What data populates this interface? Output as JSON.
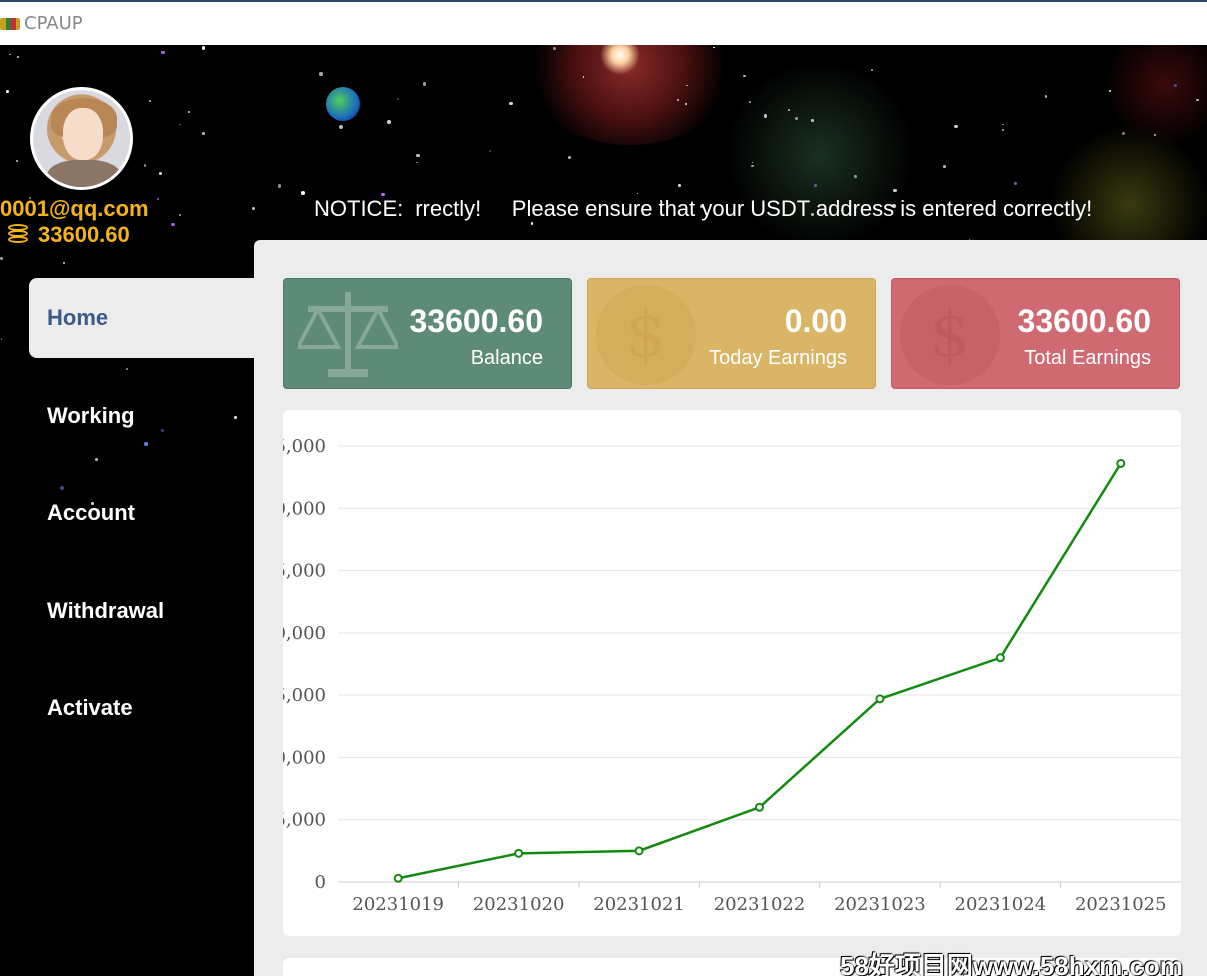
{
  "window": {
    "title": "CPAUP",
    "logo_icon": "app-logo-icon"
  },
  "user": {
    "email": "0001@qq.com",
    "balance": "33600.60",
    "coin_icon": "coins-stack-icon",
    "accent": "#f5b316"
  },
  "notice": {
    "label": "NOTICE:",
    "text": "rrectly!     Please ensure that your USDT address is entered correctly!"
  },
  "nav": {
    "items": [
      {
        "label": "Home",
        "active": true
      },
      {
        "label": "Working",
        "active": false
      },
      {
        "label": "Account",
        "active": false
      },
      {
        "label": "Withdrawal",
        "active": false
      },
      {
        "label": "Activate",
        "active": false
      }
    ]
  },
  "cards": [
    {
      "value": "33600.60",
      "label": "Balance",
      "icon": "scale-icon",
      "color": "#5e8a78"
    },
    {
      "value": "0.00",
      "label": "Today Earnings",
      "icon": "dollar-icon",
      "color": "#d9b565"
    },
    {
      "value": "33600.60",
      "label": "Total Earnings",
      "icon": "dollar-icon",
      "color": "#d06a72"
    }
  ],
  "chart_data": {
    "type": "line",
    "categories": [
      "20231019",
      "20231020",
      "20231021",
      "20231022",
      "20231023",
      "20231024",
      "20231025"
    ],
    "values": [
      300,
      2300,
      2500,
      6000,
      14700,
      18000,
      33600
    ],
    "ytick_labels": [
      "0",
      "5,000",
      "0,000",
      "5,000",
      "0,000",
      "5,000",
      "0,000",
      "5,000"
    ],
    "ylim": [
      0,
      35000
    ],
    "line_color": "#138a0f",
    "grid": true,
    "title": "",
    "xlabel": "",
    "ylabel": ""
  },
  "watermark": "58好项目网www.58hxm.com"
}
